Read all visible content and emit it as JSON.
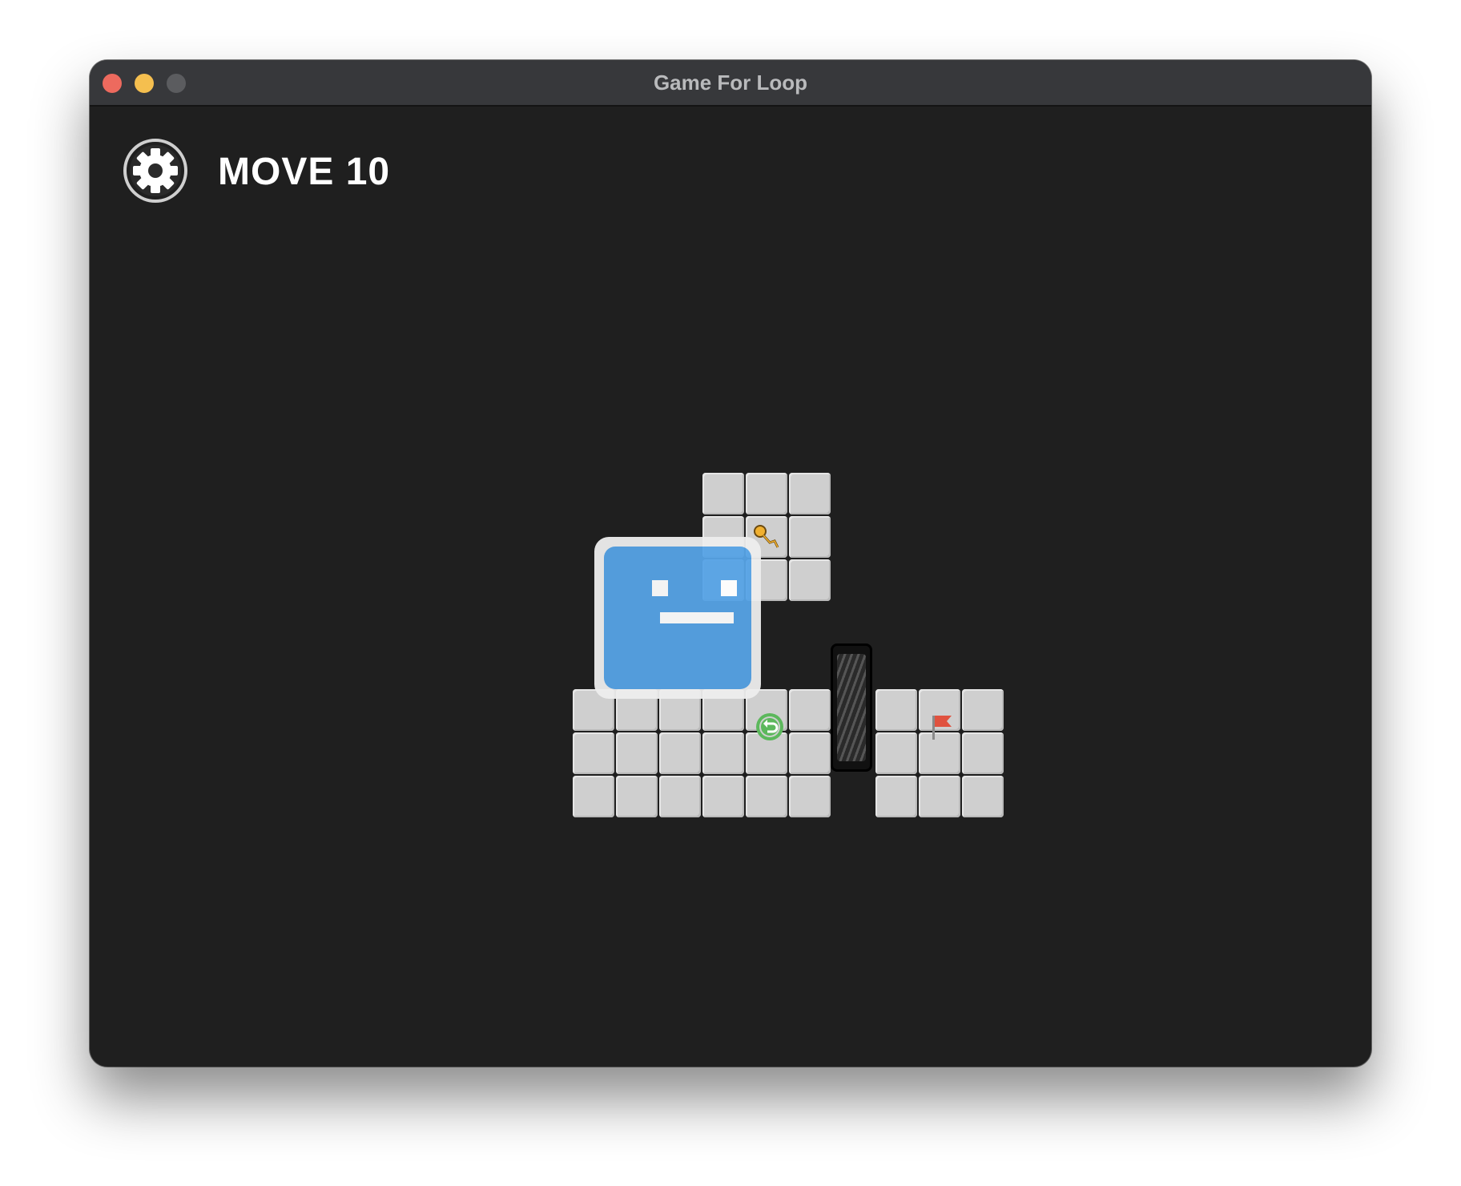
{
  "window": {
    "title": "Game For Loop",
    "traffic_lights": {
      "close": "#ed6a5e",
      "minimize": "#f5bf4f",
      "maximize": "#5b5c5f"
    }
  },
  "hud": {
    "move_label": "MOVE 10",
    "settings_icon": "gear-icon"
  },
  "colors": {
    "background": "#1f1f1f",
    "tile": "#cfcfcf",
    "player": "#56a3e6",
    "loop_token": "#5cb85c",
    "flag": "#e0523f",
    "key": "#f0b030"
  },
  "board": {
    "player": "blue-square-face",
    "items": [
      "key-icon",
      "loop-arrow-icon",
      "flag-icon",
      "locked-door"
    ]
  }
}
